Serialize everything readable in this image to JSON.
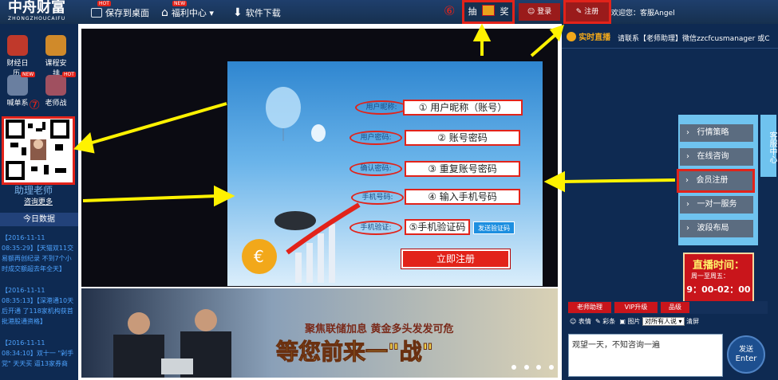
{
  "header": {
    "logo_cn": "中舟财富",
    "logo_en": "ZHONGZHOUCAIFU",
    "nav": [
      {
        "label": "保存到桌面",
        "badge": "HOT"
      },
      {
        "label": "福利中心 ▾",
        "badge": "NEW"
      },
      {
        "label": "软件下载",
        "badge": ""
      }
    ],
    "lottery_left": "抽",
    "lottery_right": "奖",
    "login": "登录",
    "register": "注册",
    "welcome": "欢迎您：客服Angel",
    "mark6": "⑥"
  },
  "sidebar": {
    "tiles": [
      {
        "label": "财经日",
        "badge": ""
      },
      {
        "label": "课程安",
        "badge": ""
      },
      {
        "label": "喊单系",
        "badge": "NEW"
      },
      {
        "label": "老师战",
        "badge": "HOT"
      }
    ],
    "sub": [
      "历",
      "排"
    ],
    "mark7": "⑦",
    "prize_label": "领奖",
    "assistant": "助理老师",
    "consult": "咨询更多",
    "today_title": "今日数据",
    "news": [
      "【2016-11-11 08:35:29】【天猫双11交易额再创纪录 不到7个小时成交额超去年全天】",
      "【2016-11-11 08:35:13】【深港通10天后开通 了118家机构获首批港股通资格】",
      "【2016-11-11 08:34:10】双十一 \"剁手党\" 天天买 逼13家券商"
    ]
  },
  "register_form": {
    "fields": [
      {
        "label": "用户昵称:",
        "value": "① 用户昵称（账号）"
      },
      {
        "label": "用户密码:",
        "value": "②    账号密码"
      },
      {
        "label": "确认密码:",
        "value": "③ 重复账号密码"
      },
      {
        "label": "手机号码:",
        "value": "④ 输入手机号码"
      },
      {
        "label": "手机验证:",
        "value": "⑤手机验证码"
      }
    ],
    "send_code": "发送验证码",
    "submit": "立即注册"
  },
  "banner": {
    "slogan": "聚焦联储加息 黄金多头发发可危",
    "big_text": "等您前来一\"战\""
  },
  "rightpanel": {
    "live_tab": "实时直播",
    "notice": "请联系【老师助理】微信zzcfcusmanager 或C",
    "services": [
      "行情策略",
      "在线咨询",
      "会员注册",
      "一对一服务",
      "波段布局"
    ],
    "vertical_label": "客服中心",
    "live_time_title": "直播时间：",
    "live_days": "周一至周五：",
    "live_hours": "9：00-02：00",
    "chat_tags": [
      "老师助理",
      "VIP升级",
      "品级"
    ],
    "chat_tools": [
      "表情",
      "彩条",
      "图片"
    ],
    "target_select": "对所有人说 ▾",
    "clear": "清屏",
    "input_text": "观望一天，不知咨询一遍",
    "send_top": "发送",
    "send_bottom": "Enter"
  },
  "colors": {
    "accent_red": "#e2231a",
    "nav_blue": "#1f3f6d",
    "arrow_yellow": "#fff200"
  }
}
